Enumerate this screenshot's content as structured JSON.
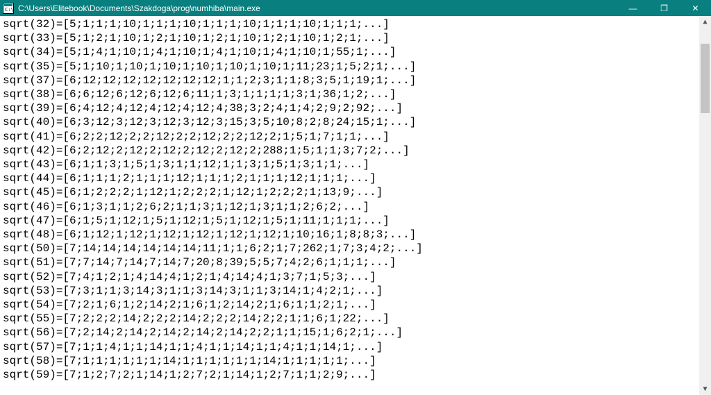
{
  "window": {
    "title": "C:\\Users\\Elitebook\\Documents\\Szakdoga\\prog\\numhiba\\main.exe"
  },
  "icons": {
    "app": "console-icon",
    "minimize": "—",
    "maximize": "❐",
    "close": "✕",
    "scroll_up": "▲",
    "scroll_down": "▼"
  },
  "colors": {
    "titlebar_bg": "#0a7f7f",
    "titlebar_fg": "#ffffff",
    "console_bg": "#ffffff",
    "console_fg": "#000000"
  },
  "lines": [
    "sqrt(32)=[5;1;1;1;10;1;1;1;10;1;1;1;10;1;1;1;10;1;1;1;...]",
    "sqrt(33)=[5;1;2;1;10;1;2;1;10;1;2;1;10;1;2;1;10;1;2;1;...]",
    "sqrt(34)=[5;1;4;1;10;1;4;1;10;1;4;1;10;1;4;1;10;1;55;1;...]",
    "sqrt(35)=[5;1;10;1;10;1;10;1;10;1;10;1;10;1;11;23;1;5;2;1;...]",
    "sqrt(37)=[6;12;12;12;12;12;12;12;1;1;2;3;1;1;8;3;5;1;19;1;...]",
    "sqrt(38)=[6;6;12;6;12;6;12;6;11;1;3;1;1;1;1;3;1;36;1;2;...]",
    "sqrt(39)=[6;4;12;4;12;4;12;4;12;4;38;3;2;4;1;4;2;9;2;92;...]",
    "sqrt(40)=[6;3;12;3;12;3;12;3;12;3;15;3;5;10;8;2;8;24;15;1;...]",
    "sqrt(41)=[6;2;2;12;2;2;12;2;2;12;2;2;12;2;1;5;1;7;1;1;...]",
    "sqrt(42)=[6;2;12;2;12;2;12;2;12;2;12;2;288;1;5;1;1;3;7;2;...]",
    "sqrt(43)=[6;1;1;3;1;5;1;3;1;1;12;1;1;3;1;5;1;3;1;1;...]",
    "sqrt(44)=[6;1;1;1;2;1;1;1;12;1;1;1;2;1;1;1;12;1;1;1;...]",
    "sqrt(45)=[6;1;2;2;2;1;12;1;2;2;2;1;12;1;2;2;2;1;13;9;...]",
    "sqrt(46)=[6;1;3;1;1;2;6;2;1;1;3;1;12;1;3;1;1;2;6;2;...]",
    "sqrt(47)=[6;1;5;1;12;1;5;1;12;1;5;1;12;1;5;1;11;1;1;1;...]",
    "sqrt(48)=[6;1;12;1;12;1;12;1;12;1;12;1;12;1;10;16;1;8;8;3;...]",
    "sqrt(50)=[7;14;14;14;14;14;14;11;1;1;6;2;1;7;262;1;7;3;4;2;...]",
    "sqrt(51)=[7;7;14;7;14;7;14;7;20;8;39;5;5;7;4;2;6;1;1;1;...]",
    "sqrt(52)=[7;4;1;2;1;4;14;4;1;2;1;4;14;4;1;3;7;1;5;3;...]",
    "sqrt(53)=[7;3;1;1;3;14;3;1;1;3;14;3;1;1;3;14;1;4;2;1;...]",
    "sqrt(54)=[7;2;1;6;1;2;14;2;1;6;1;2;14;2;1;6;1;1;2;1;...]",
    "sqrt(55)=[7;2;2;2;14;2;2;2;14;2;2;2;14;2;2;1;1;6;1;22;...]",
    "sqrt(56)=[7;2;14;2;14;2;14;2;14;2;14;2;2;1;1;15;1;6;2;1;...]",
    "sqrt(57)=[7;1;1;4;1;1;14;1;1;4;1;1;14;1;1;4;1;1;14;1;...]",
    "sqrt(58)=[7;1;1;1;1;1;1;14;1;1;1;1;1;1;14;1;1;1;1;1;...]",
    "sqrt(59)=[7;1;2;7;2;1;14;1;2;7;2;1;14;1;2;7;1;1;2;9;...]"
  ]
}
